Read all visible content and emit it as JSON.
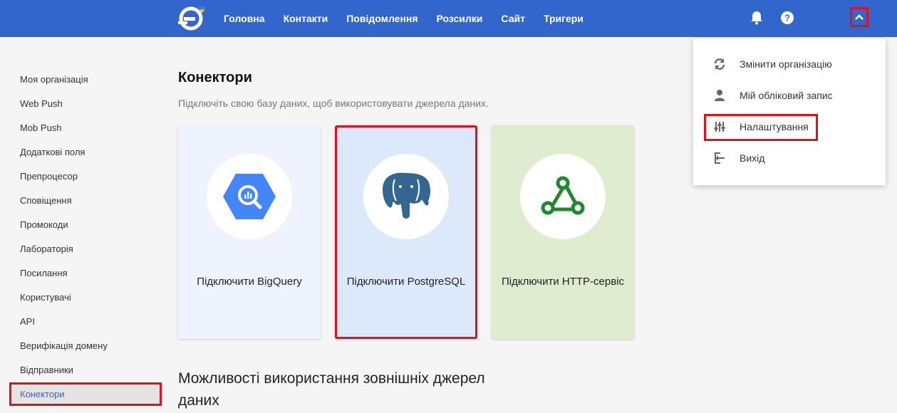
{
  "header": {
    "nav": [
      "Головна",
      "Контакти",
      "Повідомлення",
      "Розсилки",
      "Сайт",
      "Тригери"
    ],
    "icons": [
      "notification-bell-icon",
      "help-icon",
      "chevron-up-icon"
    ],
    "brand_color": "#3366cc"
  },
  "sidebar": {
    "items": [
      "Моя організація",
      "Web Push",
      "Mob Push",
      "Додаткові поля",
      "Препроцесор",
      "Сповіщення",
      "Промокоди",
      "Лабораторія",
      "Посилання",
      "Користувачі",
      "API",
      "Верифікація домену",
      "Відправники",
      "Конектори"
    ],
    "active": "Конектори"
  },
  "main": {
    "title": "Конектори",
    "subtitle": "Підключіть свою базу даних, щоб використовувати джерела даних.",
    "cards": [
      {
        "label": "Підключити BigQuery",
        "icon": "bigquery-icon"
      },
      {
        "label": "Підключити PostgreSQL",
        "icon": "postgresql-elephant-icon"
      },
      {
        "label": "Підключити HTTP-сервіс",
        "icon": "webhook-icon"
      }
    ],
    "section_title": "Можливості використання зовнішніх джерел даних"
  },
  "dropdown": {
    "items": [
      {
        "label": "Змінити організацію",
        "icon": "sync-icon"
      },
      {
        "label": "Мій обліковий запис",
        "icon": "person-icon"
      },
      {
        "label": "Налаштування",
        "icon": "sliders-icon"
      },
      {
        "label": "Вихід",
        "icon": "logout-icon"
      }
    ]
  },
  "colors": {
    "highlight": "#e0101e",
    "active_text": "#3366cc"
  }
}
